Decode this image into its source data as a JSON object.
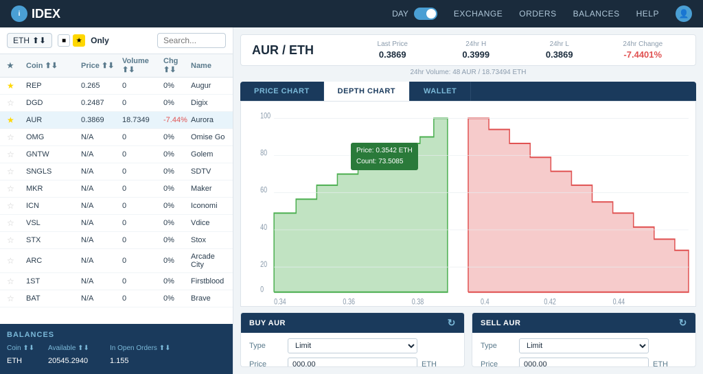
{
  "header": {
    "logo": "IDEX",
    "toggle_label": "DAY",
    "nav": [
      "EXCHANGE",
      "ORDERS",
      "BALANCES",
      "HELP"
    ]
  },
  "coin_filter": {
    "selected": "ETH",
    "only_label": "Only",
    "search_placeholder": "Search..."
  },
  "coin_table": {
    "headers": [
      "",
      "Coin",
      "Price",
      "Volume",
      "Chg",
      "Name"
    ],
    "rows": [
      {
        "star": true,
        "coin": "REP",
        "price": "0.265",
        "volume": "0",
        "chg": "0%",
        "name": "Augur",
        "active": false
      },
      {
        "star": false,
        "coin": "DGD",
        "price": "0.2487",
        "volume": "0",
        "chg": "0%",
        "name": "Digix",
        "active": false
      },
      {
        "star": true,
        "coin": "AUR",
        "price": "0.3869",
        "volume": "18.7349",
        "chg": "-7.44%",
        "name": "Aurora",
        "active": true
      },
      {
        "star": false,
        "coin": "OMG",
        "price": "N/A",
        "volume": "0",
        "chg": "0%",
        "name": "Omise Go",
        "active": false
      },
      {
        "star": false,
        "coin": "GNTW",
        "price": "N/A",
        "volume": "0",
        "chg": "0%",
        "name": "Golem",
        "active": false
      },
      {
        "star": false,
        "coin": "SNGLS",
        "price": "N/A",
        "volume": "0",
        "chg": "0%",
        "name": "SDTV",
        "active": false
      },
      {
        "star": false,
        "coin": "MKR",
        "price": "N/A",
        "volume": "0",
        "chg": "0%",
        "name": "Maker",
        "active": false
      },
      {
        "star": false,
        "coin": "ICN",
        "price": "N/A",
        "volume": "0",
        "chg": "0%",
        "name": "Iconomi",
        "active": false
      },
      {
        "star": false,
        "coin": "VSL",
        "price": "N/A",
        "volume": "0",
        "chg": "0%",
        "name": "Vdice",
        "active": false
      },
      {
        "star": false,
        "coin": "STX",
        "price": "N/A",
        "volume": "0",
        "chg": "0%",
        "name": "Stox",
        "active": false
      },
      {
        "star": false,
        "coin": "ARC",
        "price": "N/A",
        "volume": "0",
        "chg": "0%",
        "name": "Arcade City",
        "active": false
      },
      {
        "star": false,
        "coin": "1ST",
        "price": "N/A",
        "volume": "0",
        "chg": "0%",
        "name": "Firstblood",
        "active": false
      },
      {
        "star": false,
        "coin": "BAT",
        "price": "N/A",
        "volume": "0",
        "chg": "0%",
        "name": "Brave",
        "active": false
      }
    ]
  },
  "balances": {
    "title": "BALANCES",
    "headers": [
      "Coin",
      "Available",
      "In Open Orders"
    ],
    "rows": [
      {
        "coin": "ETH",
        "available": "20545.2940",
        "open_orders": "1.155"
      }
    ]
  },
  "trading_pair": {
    "pair": "AUR / ETH",
    "last_price_label": "Last Price",
    "last_price": "0.3869",
    "high_label": "24hr H",
    "high": "0.3999",
    "low_label": "24hr L",
    "low": "0.3869",
    "change_label": "24hr Change",
    "change": "-7.4401%",
    "volume_text": "24hr Volume: 48 AUR / 18.73494 ETH"
  },
  "chart_tabs": {
    "tabs": [
      "PRICE CHART",
      "DEPTH CHART",
      "WALLET"
    ],
    "active": "DEPTH CHART"
  },
  "depth_chart": {
    "tooltip_price": "Price: 0.3542 ETH",
    "tooltip_count": "Count: 73.5085",
    "x_labels": [
      "0.34",
      "0.36",
      "0.38",
      "0.4",
      "0.42",
      "0.44"
    ],
    "y_labels": [
      "0",
      "20",
      "40",
      "60",
      "80",
      "100"
    ]
  },
  "buy_panel": {
    "title": "BUY AUR",
    "type_label": "Type",
    "type_value": "Limit",
    "price_label": "Price",
    "price_value": "000.00",
    "price_unit": "ETH"
  },
  "sell_panel": {
    "title": "SELL AUR",
    "type_label": "Type",
    "type_value": "Limit",
    "price_label": "Price",
    "price_value": "000.00",
    "price_unit": "ETH"
  }
}
